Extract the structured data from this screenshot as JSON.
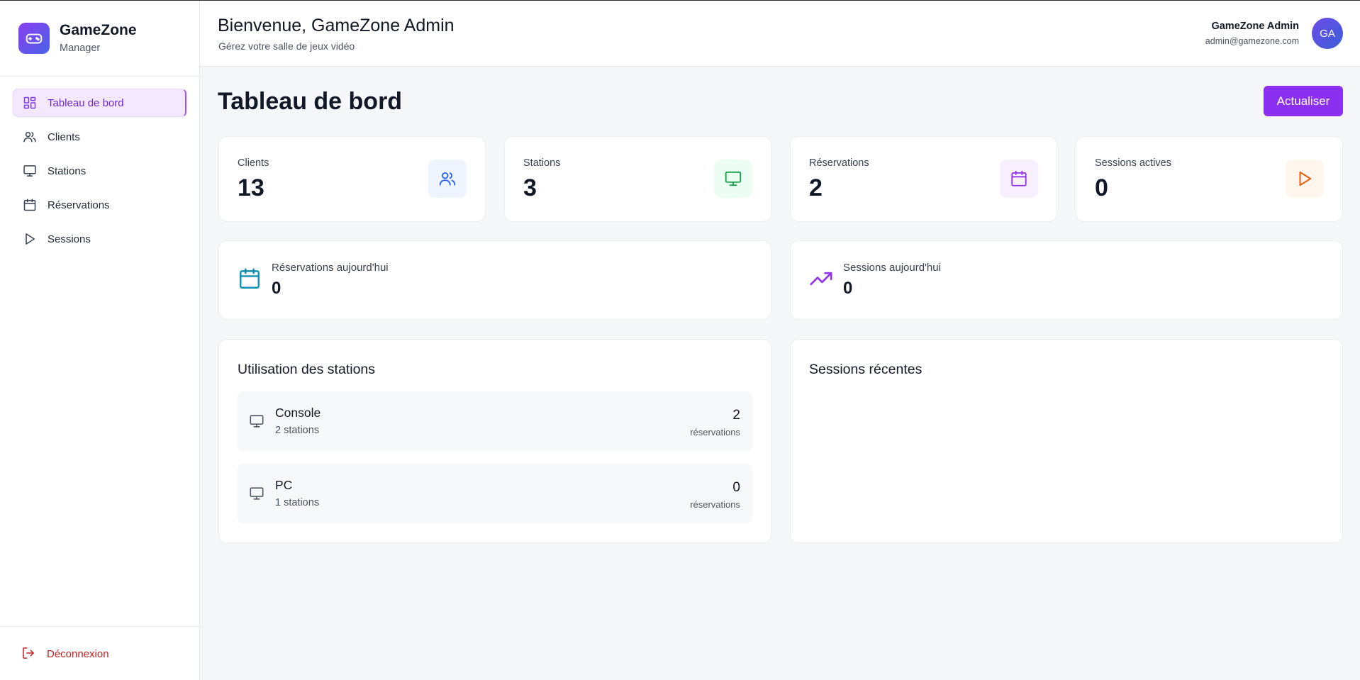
{
  "brand": {
    "name": "GameZone",
    "subtitle": "Manager",
    "logo_icon": "gamepad-icon"
  },
  "nav": {
    "items": [
      {
        "label": "Tableau de bord",
        "icon": "dashboard-grid-icon",
        "active": true
      },
      {
        "label": "Clients",
        "icon": "users-icon",
        "active": false
      },
      {
        "label": "Stations",
        "icon": "monitor-icon",
        "active": false
      },
      {
        "label": "Réservations",
        "icon": "calendar-icon",
        "active": false
      },
      {
        "label": "Sessions",
        "icon": "play-icon",
        "active": false
      }
    ],
    "logout_label": "Déconnexion"
  },
  "header": {
    "welcome": "Bienvenue, GameZone Admin",
    "subtitle": "Gérez votre salle de jeux vidéo",
    "user_name": "GameZone Admin",
    "user_email": "admin@gamezone.com",
    "avatar_initials": "GA"
  },
  "main": {
    "title": "Tableau de bord",
    "refresh_label": "Actualiser",
    "stats": [
      {
        "label": "Clients",
        "value": "13",
        "icon": "users-icon",
        "color": "#2563eb",
        "bg": "#eff5ff"
      },
      {
        "label": "Stations",
        "value": "3",
        "icon": "monitor-icon",
        "color": "#16a34a",
        "bg": "#ecfdf3"
      },
      {
        "label": "Réservations",
        "value": "2",
        "icon": "calendar-icon",
        "color": "#9333ea",
        "bg": "#f8f0ff"
      },
      {
        "label": "Sessions actives",
        "value": "0",
        "icon": "play-icon",
        "color": "#ea580c",
        "bg": "#fff6ed"
      }
    ],
    "today": [
      {
        "label": "Réservations aujourd'hui",
        "value": "0",
        "icon": "calendar-icon",
        "color": "#0e8fb5"
      },
      {
        "label": "Sessions aujourd'hui",
        "value": "0",
        "icon": "trending-up-icon",
        "color": "#9333ea"
      }
    ],
    "usage": {
      "title": "Utilisation des stations",
      "rows": [
        {
          "name": "Console",
          "count": "2 stations",
          "reservations": "2",
          "reservations_label": "réservations"
        },
        {
          "name": "PC",
          "count": "1 stations",
          "reservations": "0",
          "reservations_label": "réservations"
        }
      ]
    },
    "recent": {
      "title": "Sessions récentes"
    }
  },
  "colors": {
    "accent": "#8b2ff0",
    "logout": "#c81e1e",
    "active_nav_bg": "#f4e8ff"
  }
}
